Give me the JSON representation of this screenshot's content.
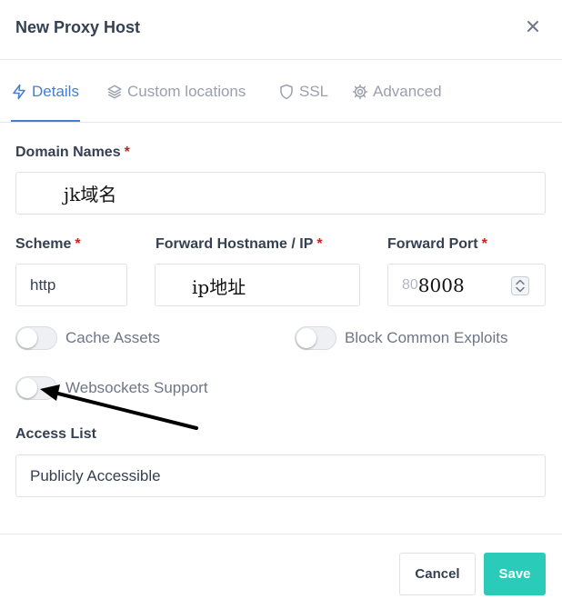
{
  "dialog": {
    "title": "New Proxy Host"
  },
  "tabs": [
    {
      "label": "Details",
      "icon": "bolt-icon",
      "active": true
    },
    {
      "label": "Custom locations",
      "icon": "layers-icon",
      "active": false
    },
    {
      "label": "SSL",
      "icon": "shield-icon",
      "active": false
    },
    {
      "label": "Advanced",
      "icon": "gear-icon",
      "active": false
    }
  ],
  "form": {
    "domain_names": {
      "label": "Domain Names",
      "required_mark": "*",
      "value": "jk域名"
    },
    "scheme": {
      "label": "Scheme",
      "required_mark": "*",
      "value": "http"
    },
    "forward_hostname": {
      "label": "Forward Hostname / IP",
      "required_mark": "*",
      "value": "ip地址"
    },
    "forward_port": {
      "label": "Forward Port",
      "required_mark": "*",
      "placeholder": "80",
      "value": "8008"
    },
    "toggles": {
      "cache_assets": {
        "label": "Cache Assets",
        "on": false
      },
      "block_exploits": {
        "label": "Block Common Exploits",
        "on": false
      },
      "websockets": {
        "label": "Websockets Support",
        "on": false
      }
    },
    "access_list": {
      "label": "Access List",
      "value": "Publicly Accessible"
    }
  },
  "footer": {
    "cancel_label": "Cancel",
    "save_label": "Save"
  },
  "colors": {
    "accent": "#467fcf",
    "save": "#2bcbba",
    "required": "#cd201f",
    "annotation_arrow": "#000000"
  }
}
